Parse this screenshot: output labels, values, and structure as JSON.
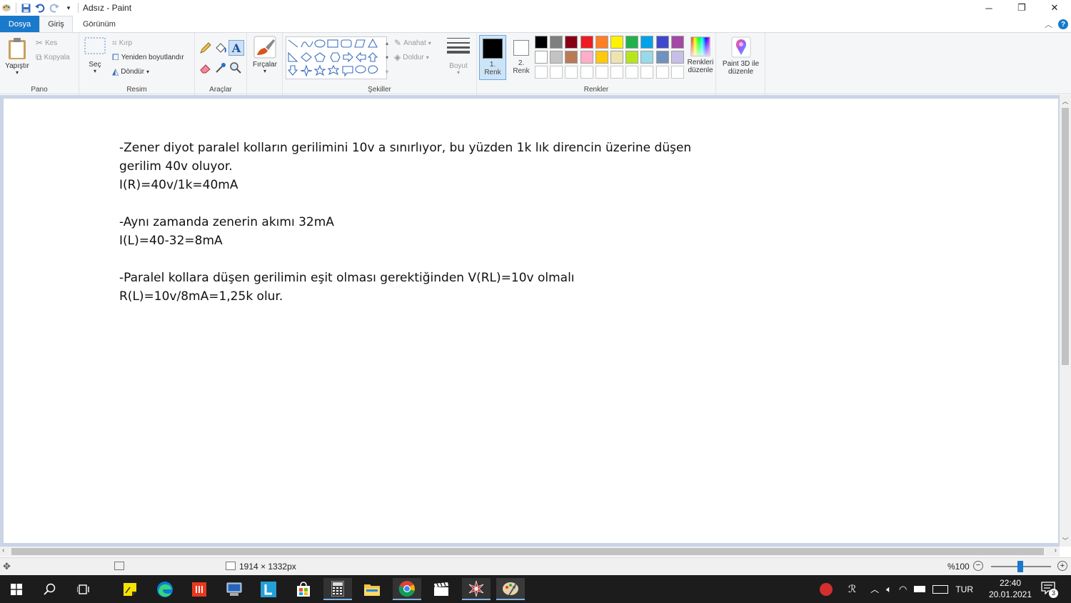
{
  "window": {
    "title": "Adsız - Paint"
  },
  "tabs": {
    "file": "Dosya",
    "home": "Giriş",
    "view": "Görünüm"
  },
  "clipboard": {
    "paste": "Yapıştır",
    "cut": "Kes",
    "copy": "Kopyala",
    "group": "Pano"
  },
  "image": {
    "select": "Seç",
    "crop": "Kırp",
    "resize": "Yeniden boyutlandır",
    "rotate": "Döndür",
    "group": "Resim"
  },
  "tools": {
    "group": "Araçlar"
  },
  "brushes": {
    "label": "Fırçalar"
  },
  "shapes": {
    "outline": "Anahat",
    "fill": "Doldur",
    "group": "Şekiller"
  },
  "size": {
    "label": "Boyut"
  },
  "colors": {
    "color1_line1": "1.",
    "color1_line2": "Renk",
    "color2_line1": "2.",
    "color2_line2": "Renk",
    "edit_line1": "Renkleri",
    "edit_line2": "düzenle",
    "group": "Renkler",
    "color1": "#000000",
    "color2": "#ffffff",
    "palette_row1": [
      "#000000",
      "#7f7f7f",
      "#880015",
      "#ed1c24",
      "#ff7f27",
      "#fff200",
      "#22b14c",
      "#00a2e8",
      "#3f48cc",
      "#a349a4"
    ],
    "palette_row2": [
      "#ffffff",
      "#c3c3c3",
      "#b97a57",
      "#ffaec9",
      "#ffc90e",
      "#efe4b0",
      "#b5e61d",
      "#99d9ea",
      "#7092be",
      "#c8bfe7"
    ]
  },
  "paint3d": {
    "line1": "Paint 3D ile",
    "line2": "düzenle"
  },
  "document_lines": [
    "-Zener diyot paralel kolların gerilimini 10v a sınırlıyor, bu yüzden 1k lık direncin üzerine düşen",
    "gerilim 40v oluyor.",
    "I(R)=40v/1k=40mA",
    "",
    "-Aynı zamanda zenerin akımı 32mA",
    "I(L)=40-32=8mA",
    "",
    "-Paralel kollara düşen gerilimin eşit olması gerektiğinden V(RL)=10v olmalı",
    "R(L)=10v/8mA=1,25k olur."
  ],
  "status": {
    "canvas_size": "1914 × 1332px",
    "zoom": "%100"
  },
  "taskbar": {
    "language": "TUR",
    "time": "22:40",
    "date": "20.01.2021",
    "notification_count": "3"
  }
}
